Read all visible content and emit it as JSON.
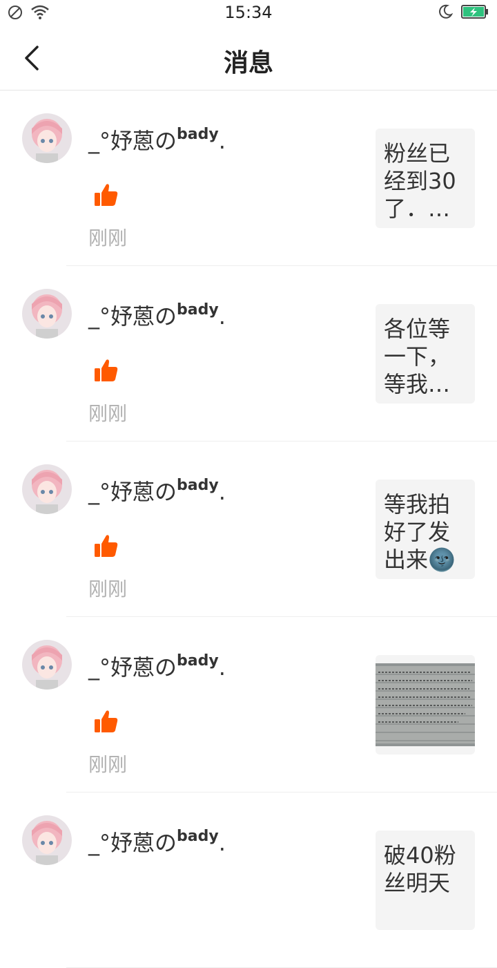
{
  "status": {
    "time": "15:34"
  },
  "header": {
    "title": "消息"
  },
  "messages": [
    {
      "name_main": "_°妤蒽の",
      "name_sup": "bady",
      "name_end": ".",
      "time": "刚刚",
      "preview_type": "text",
      "preview_text": "粉丝已经到30了．…"
    },
    {
      "name_main": "_°妤蒽の",
      "name_sup": "bady",
      "name_end": ".",
      "time": "刚刚",
      "preview_type": "text",
      "preview_text": "各位等一下，等我…"
    },
    {
      "name_main": "_°妤蒽の",
      "name_sup": "bady",
      "name_end": ".",
      "time": "刚刚",
      "preview_type": "text",
      "preview_text": "等我拍好了发出来🌚"
    },
    {
      "name_main": "_°妤蒽の",
      "name_sup": "bady",
      "name_end": ".",
      "time": "刚刚",
      "preview_type": "image",
      "preview_text": ""
    },
    {
      "name_main": "_°妤蒽の",
      "name_sup": "bady",
      "name_end": ".",
      "time": "",
      "preview_type": "text",
      "preview_text": "破40粉丝明天"
    }
  ],
  "colors": {
    "like": "#ff5a00",
    "battery": "#2ec27e"
  },
  "icons": {
    "back": "back-arrow-icon",
    "like": "thumbs-up-icon"
  }
}
